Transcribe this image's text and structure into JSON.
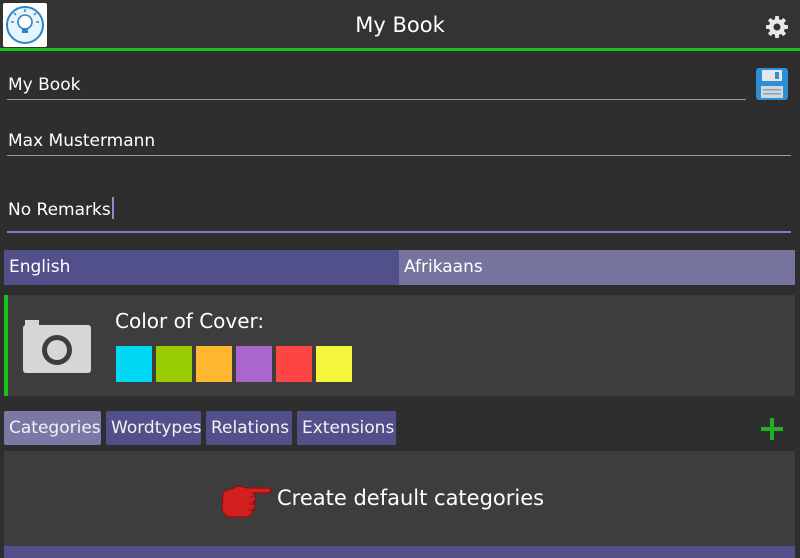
{
  "header": {
    "title": "My Book",
    "logo_icon": "lightbulb-icon",
    "settings_icon": "gear-icon",
    "accent_color": "#17c41c"
  },
  "form": {
    "book_title_value": "My Book",
    "author_value": "Max Mustermann",
    "remarks_value": "No Remarks",
    "save_icon": "floppy-disk-icon"
  },
  "languages": {
    "source": "English",
    "target": "Afrikaans"
  },
  "cover": {
    "label": "Color of Cover:",
    "camera_icon": "camera-icon",
    "colors": [
      "#00d8f5",
      "#99cc00",
      "#ffb732",
      "#aa66cc",
      "#ff4444",
      "#f5f53c"
    ]
  },
  "tabs": {
    "items": [
      "Categories",
      "Wordtypes",
      "Relations",
      "Extensions"
    ],
    "active": "Categories",
    "add_icon": "plus-icon"
  },
  "content": {
    "action_label": "Create default categories",
    "pointer_icon": "pointing-hand-icon"
  }
}
